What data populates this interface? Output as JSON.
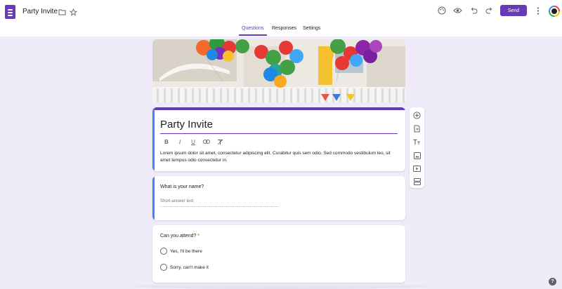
{
  "app": {
    "doc_title": "Party Invite",
    "send_label": "Send",
    "accent_color": "#673ab7",
    "background_color": "#f0ebf8"
  },
  "header_icons": [
    "palette-icon",
    "preview-eye-icon",
    "undo-icon",
    "redo-icon",
    "more-vert-icon"
  ],
  "tabs": [
    {
      "label": "Questions",
      "active": true
    },
    {
      "label": "Responses",
      "active": false
    },
    {
      "label": "Settings",
      "active": false
    }
  ],
  "form": {
    "title": "Party Invite",
    "description": "Lorem ipsum dolor sit amet, consectetur adipiscing elit. Curabitur quis sem odio. Sed commodo vestibulum leo, sit amet tempus odio consectetur in.",
    "format_tools": [
      "B",
      "I",
      "U",
      "link",
      "clear-format"
    ]
  },
  "questions": [
    {
      "title": "What is your name?",
      "type": "short-answer",
      "placeholder": "Short-answer text",
      "required": false
    },
    {
      "title": "Can you attend?",
      "type": "multiple-choice",
      "required": true,
      "required_mark": "*",
      "options": [
        "Yes,  I'll be there",
        "Sorry, can't make it"
      ]
    }
  ],
  "side_toolbar": [
    "add-question-icon",
    "import-questions-icon",
    "add-title-icon",
    "add-image-icon",
    "add-video-icon",
    "add-section-icon"
  ],
  "help": {
    "label": "?"
  }
}
